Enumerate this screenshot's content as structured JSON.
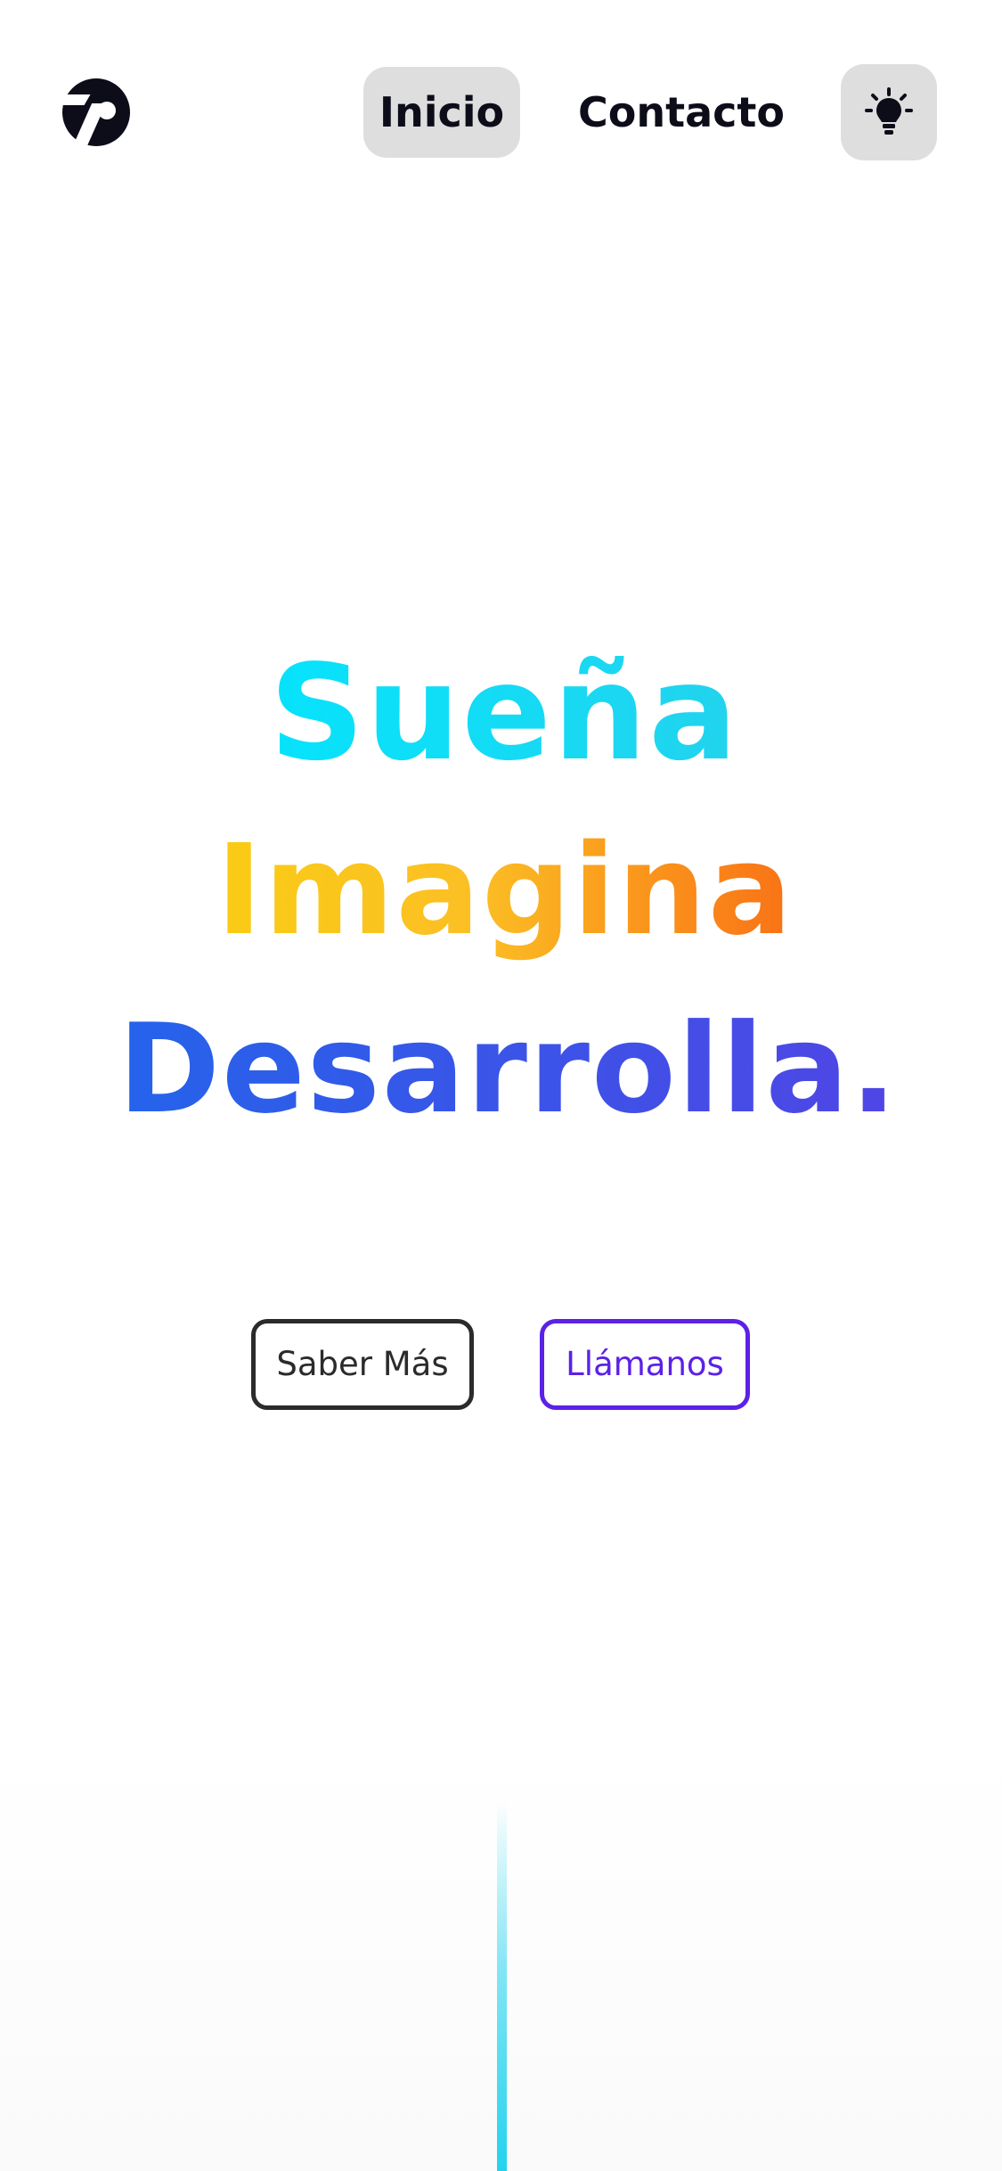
{
  "header": {
    "logo_name": "brand-logo",
    "nav": {
      "inicio_label": "Inicio",
      "contacto_label": "Contacto"
    },
    "theme_toggle_icon": "lightbulb-icon"
  },
  "hero": {
    "line1": "Sueña.",
    "line2": "Imagina.",
    "line3": "Desarrolla."
  },
  "cta": {
    "saber_mas_label": "Saber Más",
    "llamanos_label": "Llámanos"
  },
  "colors": {
    "line1_gradient": [
      "#06e3fb",
      "#22d3ee"
    ],
    "line2_gradient": [
      "#facc15",
      "#f97316"
    ],
    "line3_gradient": [
      "#2563eb",
      "#4f46e5"
    ],
    "llamanos_accent": "#5b21e6",
    "nav_pill_bg": "#dedede",
    "text_dark": "#0d0d1a",
    "scroll_line": "#22d3ee"
  }
}
